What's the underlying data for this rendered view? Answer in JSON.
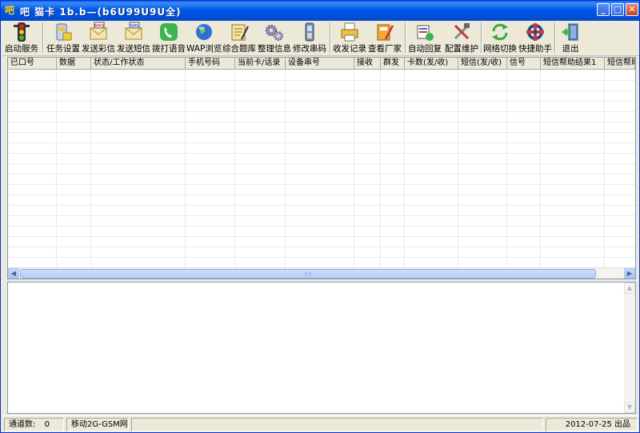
{
  "window": {
    "title": "吧 猫卡 1b.b—(b6U99U9U全)",
    "controls": {
      "minimize": "_",
      "maximize": "□",
      "close": "✕"
    }
  },
  "toolbar": {
    "buttons": [
      {
        "label": "启动服务",
        "icon": "traffic-light-icon"
      },
      {
        "label": "任务设置",
        "icon": "sim-card-icon"
      },
      {
        "label": "发送彩信",
        "icon": "mms-envelope-icon"
      },
      {
        "label": "发送短信",
        "icon": "sms-envelope-icon"
      },
      {
        "label": "拨打语音",
        "icon": "phone-icon"
      },
      {
        "label": "WAP浏览",
        "icon": "globe-icon"
      },
      {
        "label": "综合题库",
        "icon": "notepad-icon"
      },
      {
        "label": "整理信息",
        "icon": "gears-icon"
      },
      {
        "label": "修改串码",
        "icon": "mobile-phone-icon"
      },
      {
        "label": "收发记录",
        "icon": "printer-icon"
      },
      {
        "label": "查看厂家",
        "icon": "notebook-icon"
      },
      {
        "label": "自动回复",
        "icon": "auto-reply-icon"
      },
      {
        "label": "配置维护",
        "icon": "tools-icon"
      },
      {
        "label": "网络切换",
        "icon": "refresh-arrows-icon"
      },
      {
        "label": "快捷助手",
        "icon": "helper-icon"
      },
      {
        "label": "退出",
        "icon": "exit-door-icon"
      }
    ]
  },
  "grid": {
    "columns": [
      "已口号",
      "数据",
      "状态/工作状态",
      "手机号码",
      "当前卡/话录",
      "设备串号",
      "接收",
      "群发",
      "卡数(发/收)",
      "短信(发/收)",
      "信号",
      "短信帮助结果1",
      "短信帮助结果"
    ],
    "rows": []
  },
  "log": {
    "lines": []
  },
  "statusbar": {
    "channels_label": "通道数:",
    "channels_value": "0",
    "network": "移动2G-GSM网",
    "right": "2012-07-25  出品"
  },
  "colors": {
    "titlebar": "#0058e6",
    "window_bg": "#ece9d8",
    "grid_line": "#ebebeb",
    "border": "#7f9db9"
  }
}
